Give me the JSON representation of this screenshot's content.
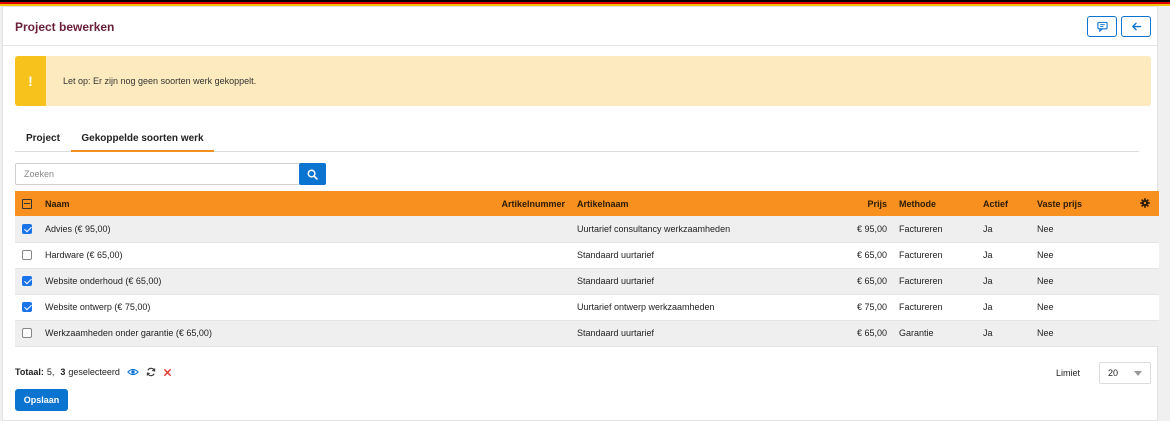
{
  "header": {
    "title": "Project bewerken"
  },
  "alert": {
    "icon": "!",
    "text": "Let op: Er zijn nog geen soorten werk gekoppelt."
  },
  "tabs": [
    {
      "label": "Project"
    },
    {
      "label": "Gekoppelde soorten werk"
    }
  ],
  "search": {
    "placeholder": "Zoeken",
    "value": ""
  },
  "table": {
    "headers": {
      "naam": "Naam",
      "artikelnummer": "Artikelnummer",
      "artikelnaam": "Artikelnaam",
      "prijs": "Prijs",
      "methode": "Methode",
      "actief": "Actief",
      "vaste_prijs": "Vaste prijs"
    },
    "rows": [
      {
        "checked": true,
        "naam": "Advies (€ 95,00)",
        "artikelnummer": "",
        "artikelnaam": "Uurtarief consultancy werkzaamheden",
        "prijs": "€ 95,00",
        "methode": "Factureren",
        "actief": "Ja",
        "vaste_prijs": "Nee"
      },
      {
        "checked": false,
        "naam": "Hardware (€ 65,00)",
        "artikelnummer": "",
        "artikelnaam": "Standaard uurtarief",
        "prijs": "€ 65,00",
        "methode": "Factureren",
        "actief": "Ja",
        "vaste_prijs": "Nee"
      },
      {
        "checked": true,
        "naam": "Website onderhoud (€ 65,00)",
        "artikelnummer": "",
        "artikelnaam": "Standaard uurtarief",
        "prijs": "€ 65,00",
        "methode": "Factureren",
        "actief": "Ja",
        "vaste_prijs": "Nee"
      },
      {
        "checked": true,
        "naam": "Website ontwerp (€ 75,00)",
        "artikelnummer": "",
        "artikelnaam": "Uurtarief ontwerp werkzaamheden",
        "prijs": "€ 75,00",
        "methode": "Factureren",
        "actief": "Ja",
        "vaste_prijs": "Nee"
      },
      {
        "checked": false,
        "naam": "Werkzaamheden onder garantie (€ 65,00)",
        "artikelnummer": "",
        "artikelnaam": "Standaard uurtarief",
        "prijs": "€ 65,00",
        "methode": "Garantie",
        "actief": "Ja",
        "vaste_prijs": "Nee"
      }
    ]
  },
  "footer": {
    "total_label": "Totaal:",
    "total_count": "5,",
    "selected_count": "3",
    "selected_label": "geselecteerd",
    "limit_label": "Limiet",
    "limit_value": "20"
  },
  "save_label": "Opslaan",
  "colors": {
    "accent": "#0b74d1",
    "table_header": "#f7901e",
    "alert_bg": "#fdebbf",
    "alert_icon": "#f8c21c",
    "title": "#6a1f3a"
  },
  "icons": {
    "comment": "comment-icon",
    "back": "arrow-left-icon",
    "search": "search-icon",
    "settings": "gear-icon",
    "view": "eye-icon",
    "refresh": "refresh-icon",
    "clear": "close-icon"
  }
}
